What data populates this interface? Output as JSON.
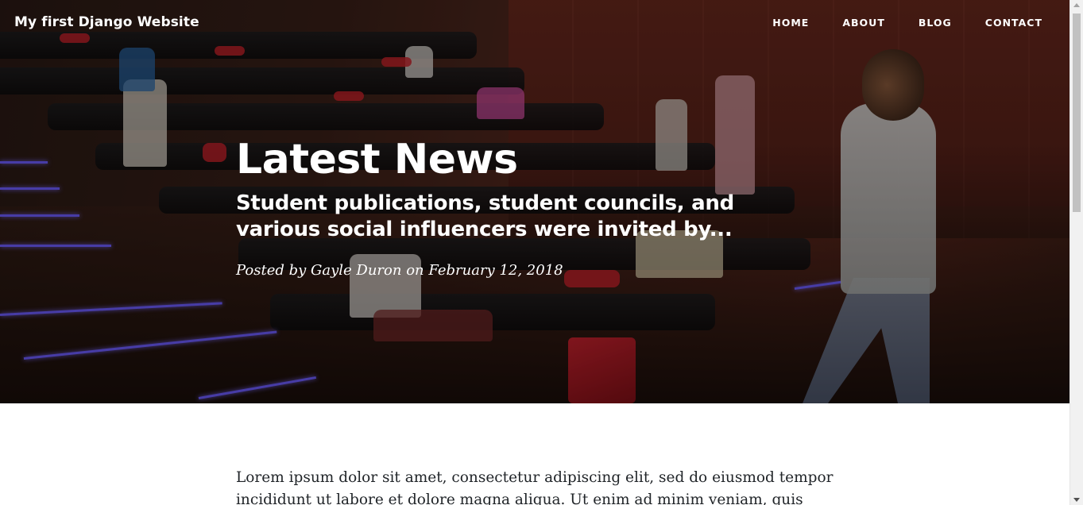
{
  "site": {
    "brand": "My first Django Website"
  },
  "nav": {
    "items": [
      {
        "label": "HOME"
      },
      {
        "label": "ABOUT"
      },
      {
        "label": "BLOG"
      },
      {
        "label": "CONTACT"
      }
    ]
  },
  "hero": {
    "title": "Latest News",
    "subtitle": " Student publications, student councils, and various social influencers were invited by...",
    "meta": "Posted by Gayle Duron on February 12, 2018",
    "image_description_colors": {
      "wall": "#6e2a1f",
      "stair_light": "#6d5cff"
    }
  },
  "article": {
    "body": "Lorem ipsum dolor sit amet, consectetur adipiscing elit, sed do eiusmod tempor incididunt ut labore et dolore magna aliqua. Ut enim ad minim veniam, quis"
  }
}
